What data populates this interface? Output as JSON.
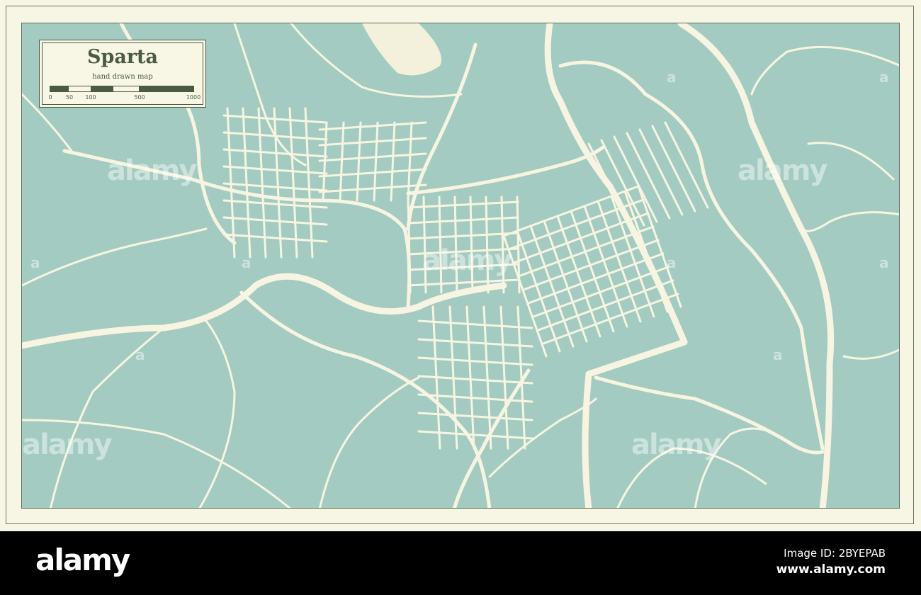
{
  "map": {
    "title": "Sparta",
    "subtitle": "hand drawn map",
    "scale_labels": [
      "0",
      "50",
      "100",
      "500",
      "1000"
    ],
    "colors": {
      "land": "#a3cbc1",
      "roads": "#f7f5e1",
      "frame": "#f7f5e3",
      "ink": "#4a5a45"
    }
  },
  "watermark": {
    "text": "alamy",
    "small": "a"
  },
  "footer": {
    "brand": "alamy",
    "image_id": "Image ID: 2BYEPAB",
    "url": "www.alamy.com"
  }
}
